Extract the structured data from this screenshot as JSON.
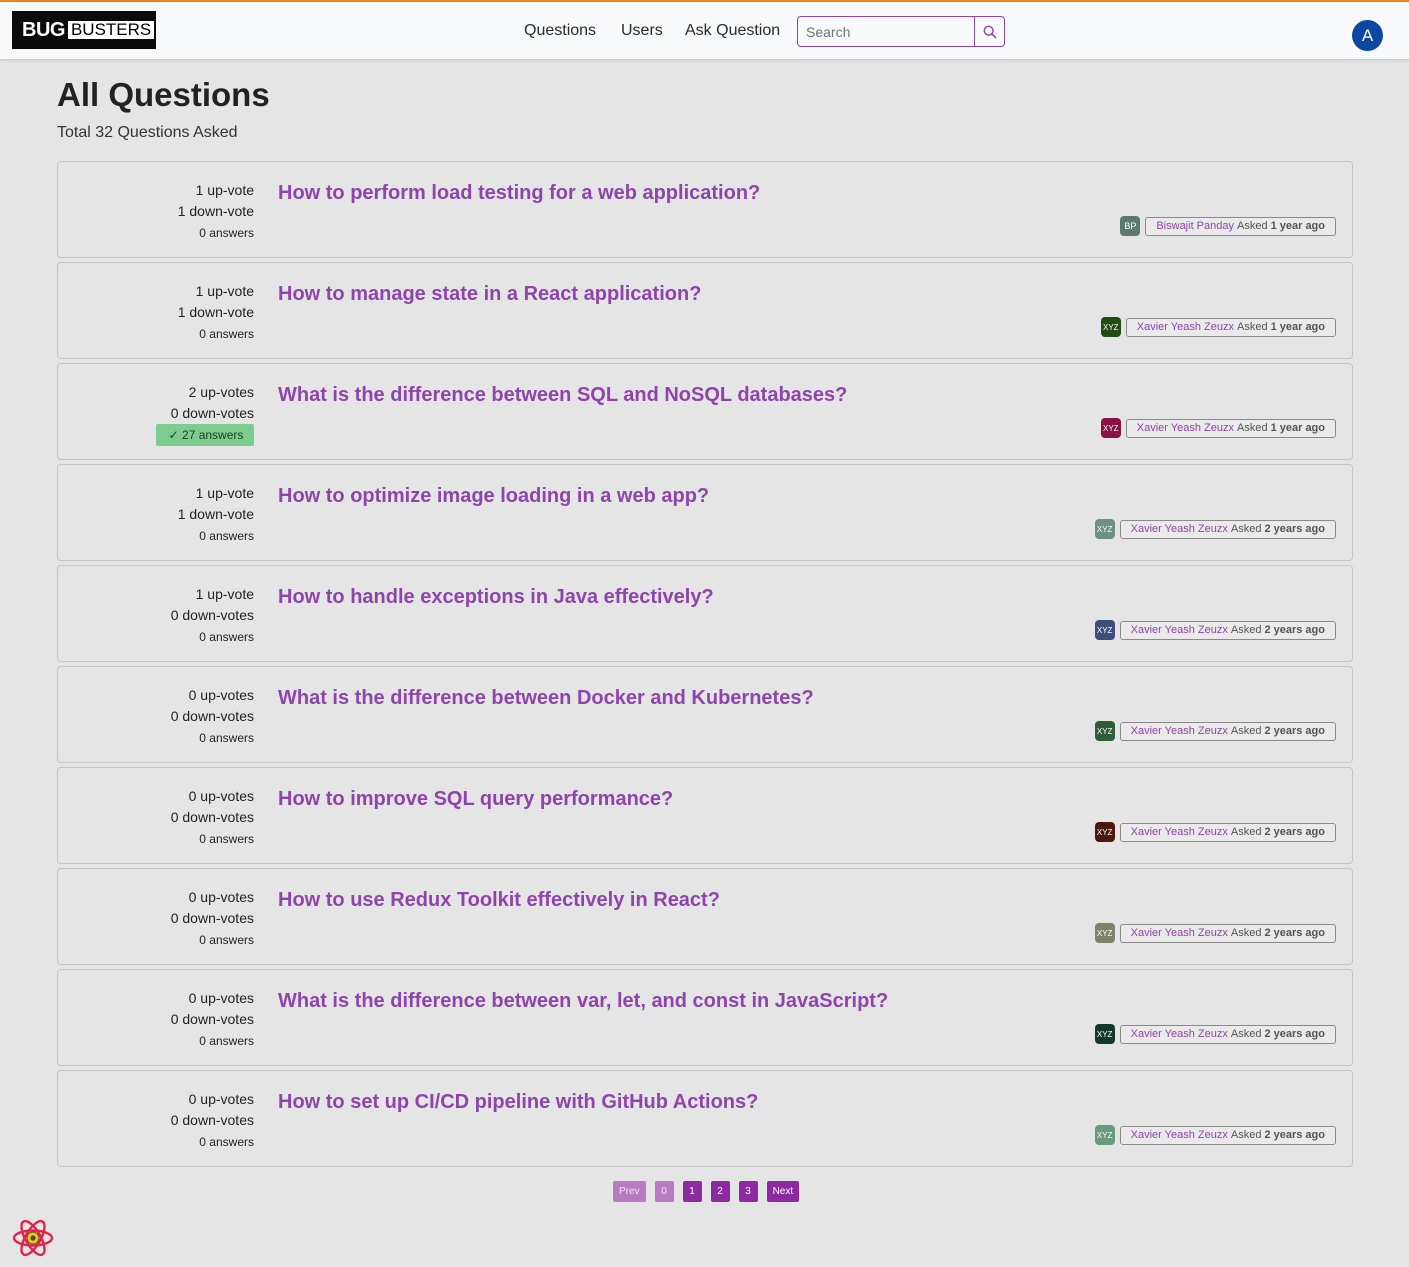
{
  "brand": {
    "part1": "BUG",
    "part2": "BUSTERS"
  },
  "nav": {
    "questions": "Questions",
    "users": "Users",
    "ask": "Ask Question"
  },
  "search": {
    "placeholder": "Search"
  },
  "user_avatar": "A",
  "page": {
    "title": "All Questions",
    "subtitle": "Total 32 Questions Asked"
  },
  "questions": [
    {
      "up": "1 up-vote",
      "down": "1 down-vote",
      "answers": "0 answers",
      "accepted": false,
      "title": "How to perform load testing for a web application?",
      "avatar": "BP",
      "avatar_color": "#5e7a6e",
      "author": "Biswajit Panday",
      "asked": "Asked",
      "ago": "1 year ago"
    },
    {
      "up": "1 up-vote",
      "down": "1 down-vote",
      "answers": "0 answers",
      "accepted": false,
      "title": "How to manage state in a React application?",
      "avatar": "XYZ",
      "avatar_color": "#1f4d12",
      "author": "Xavier Yeash Zeuzx",
      "asked": "Asked",
      "ago": "1 year ago"
    },
    {
      "up": "2 up-votes",
      "down": "0 down-votes",
      "answers": "27 answers",
      "accepted": true,
      "title": "What is the difference between SQL and NoSQL databases?",
      "avatar": "XYZ",
      "avatar_color": "#8a1143",
      "author": "Xavier Yeash Zeuzx",
      "asked": "Asked",
      "ago": "1 year ago"
    },
    {
      "up": "1 up-vote",
      "down": "1 down-vote",
      "answers": "0 answers",
      "accepted": false,
      "title": "How to optimize image loading in a web app?",
      "avatar": "XYZ",
      "avatar_color": "#6f9083",
      "author": "Xavier Yeash Zeuzx",
      "asked": "Asked",
      "ago": "2 years ago"
    },
    {
      "up": "1 up-vote",
      "down": "0 down-votes",
      "answers": "0 answers",
      "accepted": false,
      "title": "How to handle exceptions in Java effectively?",
      "avatar": "XYZ",
      "avatar_color": "#3c4f7a",
      "author": "Xavier Yeash Zeuzx",
      "asked": "Asked",
      "ago": "2 years ago"
    },
    {
      "up": "0 up-votes",
      "down": "0 down-votes",
      "answers": "0 answers",
      "accepted": false,
      "title": "What is the difference between Docker and Kubernetes?",
      "avatar": "XYZ",
      "avatar_color": "#2f5c3b",
      "author": "Xavier Yeash Zeuzx",
      "asked": "Asked",
      "ago": "2 years ago"
    },
    {
      "up": "0 up-votes",
      "down": "0 down-votes",
      "answers": "0 answers",
      "accepted": false,
      "title": "How to improve SQL query performance?",
      "avatar": "XYZ",
      "avatar_color": "#4a1a0e",
      "author": "Xavier Yeash Zeuzx",
      "asked": "Asked",
      "ago": "2 years ago"
    },
    {
      "up": "0 up-votes",
      "down": "0 down-votes",
      "answers": "0 answers",
      "accepted": false,
      "title": "How to use Redux Toolkit effectively in React?",
      "avatar": "XYZ",
      "avatar_color": "#7f8266",
      "author": "Xavier Yeash Zeuzx",
      "asked": "Asked",
      "ago": "2 years ago"
    },
    {
      "up": "0 up-votes",
      "down": "0 down-votes",
      "answers": "0 answers",
      "accepted": false,
      "title": "What is the difference between var, let, and const in JavaScript?",
      "avatar": "XYZ",
      "avatar_color": "#123a2c",
      "author": "Xavier Yeash Zeuzx",
      "asked": "Asked",
      "ago": "2 years ago"
    },
    {
      "up": "0 up-votes",
      "down": "0 down-votes",
      "answers": "0 answers",
      "accepted": false,
      "title": "How to set up CI/CD pipeline with GitHub Actions?",
      "avatar": "XYZ",
      "avatar_color": "#6a9a7f",
      "author": "Xavier Yeash Zeuzx",
      "asked": "Asked",
      "ago": "2 years ago"
    }
  ],
  "pagination": {
    "prev": "Prev",
    "pages": [
      "0",
      "1",
      "2",
      "3"
    ],
    "next": "Next"
  },
  "colors": {
    "accent": "#8e44ad",
    "topbar_border": "#f48024",
    "accepted_bg": "#7dcc8f"
  }
}
